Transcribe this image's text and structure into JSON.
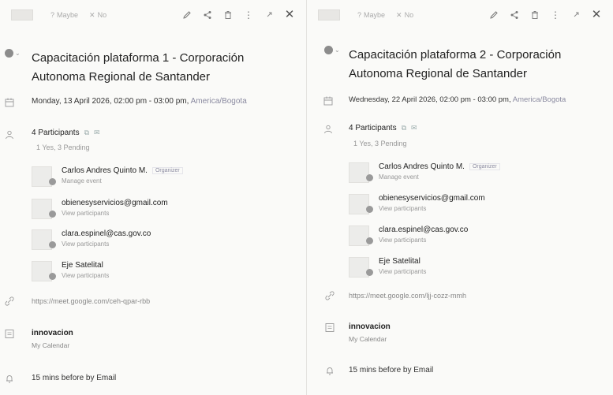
{
  "left": {
    "toolbar": {
      "opt1": "Maybe",
      "opt2": "No"
    },
    "title": "Capacitación plataforma 1 - Corporación Autonoma Regional de Santander",
    "date": "Monday, 13 April 2026, 02:00 pm - 03:00 pm,",
    "timezone": "America/Bogota",
    "participants_title": "4 Participants",
    "participants_summary": "1 Yes, 3 Pending",
    "participants": [
      {
        "name": "Carlos Andres Quinto M.",
        "role": "Organizer",
        "sub": "Manage event"
      },
      {
        "name": "obienesyservicios@gmail.com",
        "sub": "View participants"
      },
      {
        "name": "clara.espinel@cas.gov.co",
        "sub": "View participants"
      },
      {
        "name": "Eje Satelital",
        "sub": "View participants"
      }
    ],
    "meet_link": "https://meet.google.com/ceh-qpar-rbb",
    "calendar_name": "innovacion",
    "calendar_sub": "My Calendar",
    "reminder": "15 mins before by Email"
  },
  "right": {
    "toolbar": {
      "opt1": "Maybe",
      "opt2": "No"
    },
    "title": "Capacitación plataforma 2 - Corporación Autonoma Regional de Santander",
    "date": "Wednesday, 22 April 2026, 02:00 pm - 03:00 pm,",
    "timezone": "America/Bogota",
    "participants_title": "4 Participants",
    "participants_summary": "1 Yes, 3 Pending",
    "participants": [
      {
        "name": "Carlos Andres Quinto M.",
        "role": "Organizer",
        "sub": "Manage event"
      },
      {
        "name": "obienesyservicios@gmail.com",
        "sub": "View participants"
      },
      {
        "name": "clara.espinel@cas.gov.co",
        "sub": "View participants"
      },
      {
        "name": "Eje Satelital",
        "sub": "View participants"
      }
    ],
    "meet_link": "https://meet.google.com/ljj-cozz-mmh",
    "calendar_name": "innovacion",
    "calendar_sub": "My Calendar",
    "reminder": "15 mins before by Email"
  },
  "icons": {
    "edit": "pencil-icon",
    "share": "share-icon",
    "delete": "trash-icon",
    "more": "more-vertical-icon",
    "expand": "expand-icon",
    "close": "close-icon",
    "calendar": "calendar-icon",
    "participants": "people-icon",
    "link": "link-icon",
    "reminder": "bell-icon"
  },
  "colors": {
    "accent_timezone": "#8a8aa0"
  }
}
